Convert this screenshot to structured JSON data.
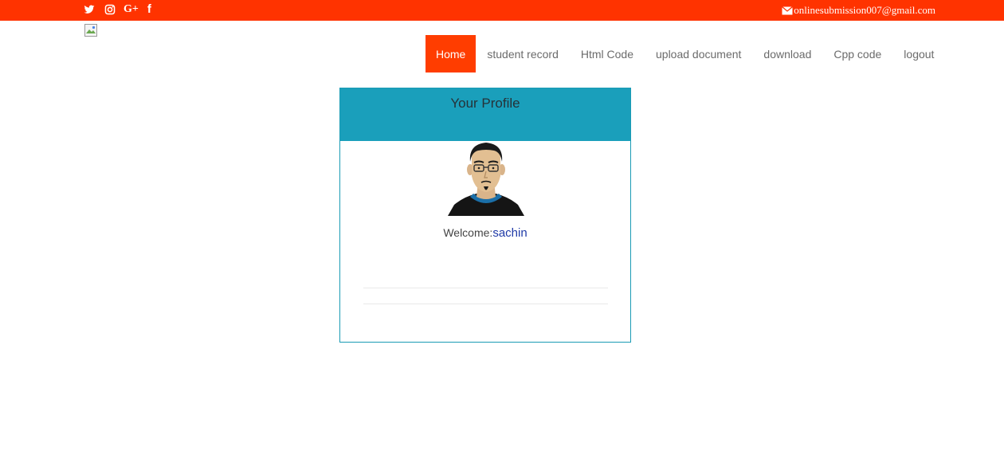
{
  "topbar": {
    "bg_color": "#ff3300",
    "social_icons": [
      "twitter-icon",
      "instagram-icon",
      "google-plus-icon",
      "facebook-icon"
    ],
    "google_plus_glyph": "G+",
    "facebook_glyph": "f",
    "email": "onlinesubmission007@gmail.com"
  },
  "nav": {
    "active_color": "#ff3d00",
    "items": [
      {
        "label": "Home"
      },
      {
        "label": "student record"
      },
      {
        "label": "Html Code"
      },
      {
        "label": "upload document"
      },
      {
        "label": "download"
      },
      {
        "label": "Cpp code"
      },
      {
        "label": "logout"
      }
    ]
  },
  "profile": {
    "header_color": "#1a9fbb",
    "title": "Your Profile",
    "welcome_label": "Welcome:",
    "username": "sachin"
  }
}
